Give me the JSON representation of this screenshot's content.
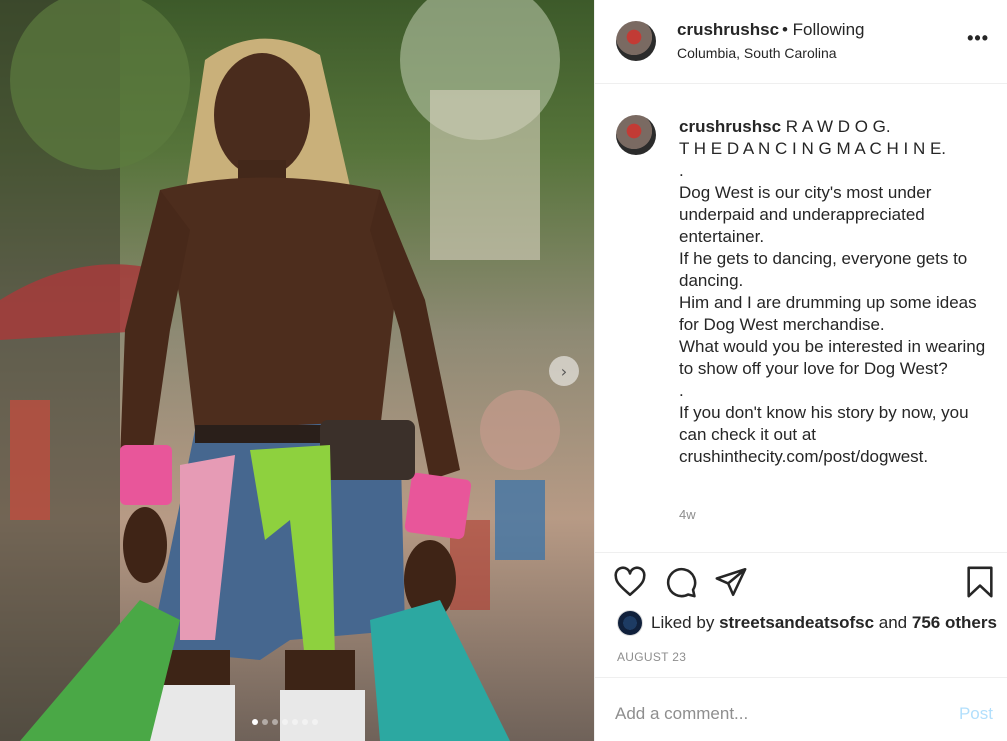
{
  "header": {
    "username": "crushrushsc",
    "follow_status": "• Following",
    "location": "Columbia, South Carolina",
    "more_icon": "•••"
  },
  "caption": {
    "username": "crushrushsc",
    "lines": [
      "R A W D O G.",
      "T H E D A N C I N G M A C H I N E.",
      ".",
      "Dog West is our city's most under underpaid and underappreciated entertainer.",
      "If he gets to dancing, everyone gets to dancing.",
      "Him and I are drumming up some ideas for Dog West merchandise.",
      "What would you be interested in wearing to show off your love for Dog West?",
      ".",
      "If you don't know his story by now, you can check it out at crushinthecity.com/post/dogwest."
    ],
    "time_ago": "4w"
  },
  "likes": {
    "prefix": "Liked by",
    "user": "streetsandeatsofsc",
    "and": "and",
    "others": "756 others"
  },
  "date": "AUGUST 23",
  "comment": {
    "placeholder": "Add a comment...",
    "post_label": "Post"
  },
  "carousel": {
    "next_icon": "›",
    "total_slides": 7,
    "active_slide": 1
  },
  "icons": {
    "like": "heart-icon",
    "comment": "comment-icon",
    "share": "paper-plane-icon",
    "save": "bookmark-icon"
  },
  "colors": {
    "text": "#262626",
    "muted": "#8e8e8e",
    "post_disabled": "#b2dffc",
    "divider": "#efefef"
  }
}
